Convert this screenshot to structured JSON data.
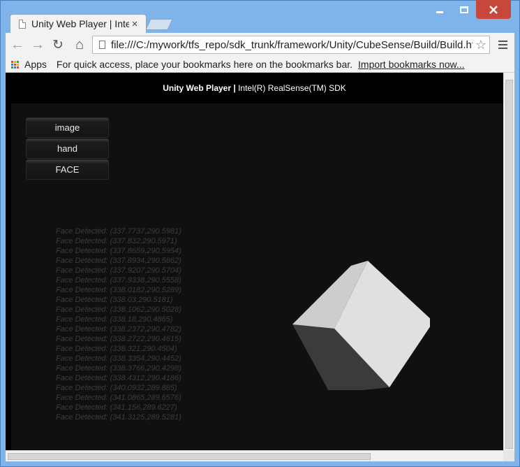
{
  "tab": {
    "title": "Unity Web Player | Intel(R) RealSense(TM) SDK",
    "close_glyph": "×"
  },
  "toolbar": {
    "back_glyph": "←",
    "forward_glyph": "→",
    "reload_glyph": "↻",
    "home_glyph": "⌂",
    "url": "file:///C:/mywork/tfs_repo/sdk_trunk/framework/Unity/CubeSense/Build/Build.html",
    "star_glyph": "☆"
  },
  "bookmarks": {
    "apps_label": "Apps",
    "hint": "For quick access, place your bookmarks here on the bookmarks bar.",
    "import_link": "Import bookmarks now..."
  },
  "page": {
    "header_title": "Unity Web Player |",
    "header_subtitle": " Intel(R) RealSense(TM) SDK"
  },
  "buttons": [
    {
      "label": "image"
    },
    {
      "label": "hand"
    },
    {
      "label": "FACE"
    }
  ],
  "log": [
    "Face Detected: (337.7737,290.5981)",
    "Face Detected: (337.832,290.5971)",
    "Face Detected: (337.8659,290.5954)",
    "Face Detected: (337.8934,290.5862)",
    "Face Detected: (337.9207,290.5704)",
    "Face Detected: (337.9338,290.5558)",
    "Face Detected: (338.0182,290.5289)",
    "Face Detected: (338.03,290.5181)",
    "Face Detected: (338.1062,290.5028)",
    "Face Detected: (338.18,290.4865)",
    "Face Detected: (338.2372,290.4782)",
    "Face Detected: (338.2722,290.4615)",
    "Face Detected: (338.321,290.4504)",
    "Face Detected: (338.3354,290.4452)",
    "Face Detected: (338.3766,290.4298)",
    "Face Detected: (338.4312,290.4186)",
    "Face Detected: (340.0932,289.885)",
    "Face Detected: (341.0865,289.6576)",
    "Face Detected: (341.156,289.6227)",
    "Face Detected: (341.3125,289.5281)"
  ],
  "colors": {
    "window_frame": "#7eb4ea",
    "close_button": "#c7483b",
    "canvas_background": "#0f110f",
    "log_text": "#3c3c3c",
    "cube_top": "#cdcdcd",
    "cube_right": "#e0e0e0",
    "cube_left": "#3b3b3b"
  }
}
